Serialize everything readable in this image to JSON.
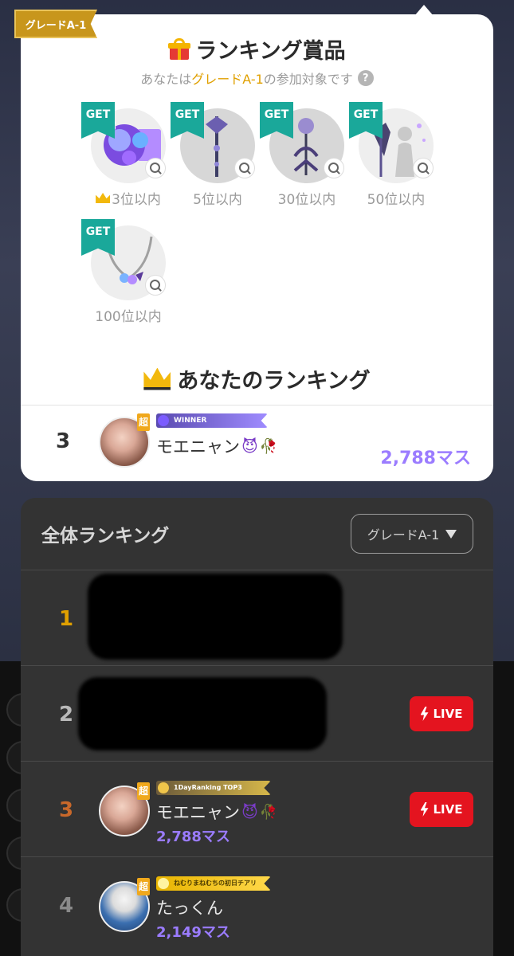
{
  "grade_tag": "グレードA-1",
  "prize_section": {
    "title": "ランキング賞品",
    "subtitle_before": "あなたは",
    "subtitle_grade": "グレードA-1",
    "subtitle_after": "の参加対象です",
    "help": "?",
    "get_label": "GET",
    "prizes": [
      {
        "label": "3位以内",
        "icon": "crown-icon"
      },
      {
        "label": "5位以内"
      },
      {
        "label": "30位以内"
      },
      {
        "label": "50位以内"
      },
      {
        "label": "100位以内"
      }
    ]
  },
  "my_ranking": {
    "title": "あなたのランキング",
    "rank": "3",
    "super": "超",
    "badge_text": "WINNER",
    "name": "モエニャン",
    "emoji": [
      "😈",
      "🥀"
    ],
    "score": "2,788マス"
  },
  "overall": {
    "title": "全体ランキング",
    "grade_select": "グレードA-1",
    "live_label": "LIVE",
    "rows": [
      {
        "rank": "1",
        "rank_color": "#e0a000"
      },
      {
        "rank": "2",
        "rank_color": "#b8b8b8",
        "live": true
      },
      {
        "rank": "3",
        "rank_color": "#c9682a",
        "live": true,
        "super": "超",
        "badge_text": "1DayRanking TOP3",
        "name": "モエニャン",
        "emoji": [
          "😈",
          "🥀"
        ],
        "score": "2,788マス"
      },
      {
        "rank": "4",
        "rank_color": "#8a8a8a",
        "super": "超",
        "badge_text": "ねむりまねむちの初日チアリ",
        "name": "たっくん",
        "score": "2,149マス"
      }
    ]
  },
  "colors": {
    "accent_purple": "#9b7cff",
    "gold": "#e0a000",
    "live_red": "#e4141f",
    "get_teal": "#1aa89a"
  }
}
